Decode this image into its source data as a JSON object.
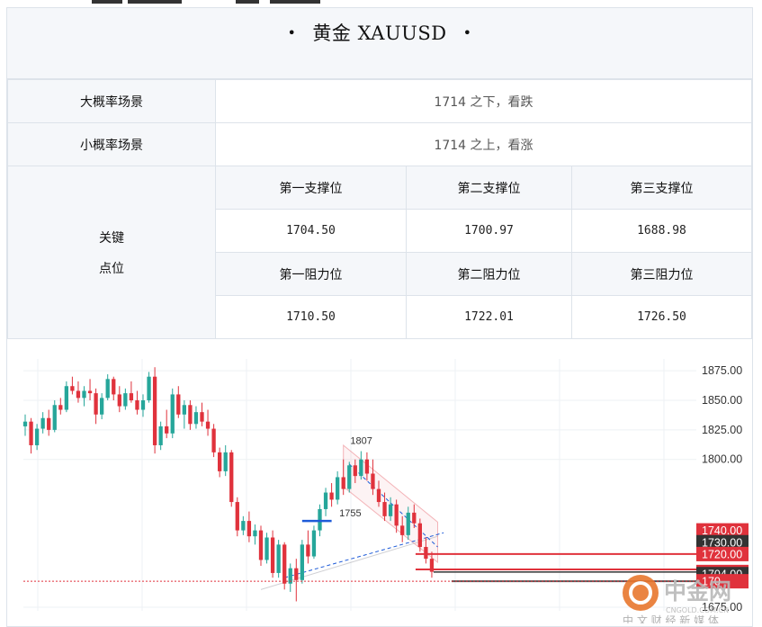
{
  "card": {
    "title": "黄金 XAUUSD",
    "bullet": "•"
  },
  "scenarios": {
    "major_label": "大概率场景",
    "major_text": "1714 之下，看跌",
    "minor_label": "小概率场景",
    "minor_text": "1714 之上，看涨"
  },
  "key_levels": {
    "label_line1": "关键",
    "label_line2": "点位",
    "support_headers": [
      "第一支撑位",
      "第二支撑位",
      "第三支撑位"
    ],
    "support_values": [
      "1704.50",
      "1700.97",
      "1688.98"
    ],
    "resistance_headers": [
      "第一阻力位",
      "第二阻力位",
      "第三阻力位"
    ],
    "resistance_values": [
      "1710.50",
      "1722.01",
      "1726.50"
    ]
  },
  "chart": {
    "y_axis_labels": [
      "1875.00",
      "1850.00",
      "1825.00",
      "1800.00",
      "1675.00"
    ],
    "price_tags": [
      {
        "label": "1740.00",
        "color": "#e0323c"
      },
      {
        "label": "1730.00",
        "color": "#333333"
      },
      {
        "label": "1720.00",
        "color": "#e0323c"
      },
      {
        "label": "1704.81",
        "color": "#e0323c"
      },
      {
        "label": "1704.00",
        "color": "#333333"
      },
      {
        "label": "170",
        "color": "#e0323c"
      }
    ],
    "annotations": {
      "high": "1807",
      "low": "1755"
    },
    "colors": {
      "up": "#26a69a",
      "down": "#e0323c",
      "grid": "#eef1f4"
    }
  },
  "watermark": {
    "brand": "中金网",
    "domain": "CNGOLD.COM.CN",
    "tagline": "中 文 财 经 新 媒 体"
  },
  "chart_data": {
    "type": "candlestick",
    "title": "",
    "xlabel": "",
    "ylabel": "",
    "ylim": [
      1672,
      1885
    ],
    "y_ticks": [
      1875,
      1850,
      1825,
      1800,
      1675
    ],
    "levels": [
      1740.0,
      1730.0,
      1720.0,
      1704.81,
      1704.0,
      1700.0
    ],
    "annotations": [
      {
        "label": "1807",
        "value": 1807
      },
      {
        "label": "1755",
        "value": 1755
      }
    ],
    "grid": true,
    "candles": [
      [
        1828,
        1838,
        1820,
        1832
      ],
      [
        1832,
        1835,
        1805,
        1812
      ],
      [
        1812,
        1830,
        1808,
        1826
      ],
      [
        1826,
        1840,
        1822,
        1835
      ],
      [
        1835,
        1842,
        1820,
        1825
      ],
      [
        1825,
        1850,
        1823,
        1846
      ],
      [
        1846,
        1852,
        1838,
        1842
      ],
      [
        1842,
        1866,
        1840,
        1862
      ],
      [
        1862,
        1870,
        1855,
        1858
      ],
      [
        1858,
        1866,
        1848,
        1852
      ],
      [
        1852,
        1862,
        1845,
        1858
      ],
      [
        1858,
        1868,
        1850,
        1856
      ],
      [
        1856,
        1860,
        1830,
        1838
      ],
      [
        1838,
        1856,
        1834,
        1852
      ],
      [
        1852,
        1872,
        1850,
        1868
      ],
      [
        1868,
        1870,
        1850,
        1855
      ],
      [
        1855,
        1862,
        1840,
        1845
      ],
      [
        1845,
        1860,
        1842,
        1856
      ],
      [
        1856,
        1866,
        1848,
        1850
      ],
      [
        1850,
        1858,
        1838,
        1842
      ],
      [
        1842,
        1855,
        1836,
        1850
      ],
      [
        1850,
        1874,
        1848,
        1870
      ],
      [
        1870,
        1878,
        1805,
        1812
      ],
      [
        1812,
        1832,
        1808,
        1828
      ],
      [
        1828,
        1842,
        1818,
        1822
      ],
      [
        1822,
        1860,
        1818,
        1855
      ],
      [
        1855,
        1862,
        1835,
        1838
      ],
      [
        1838,
        1850,
        1826,
        1846
      ],
      [
        1846,
        1850,
        1825,
        1830
      ],
      [
        1830,
        1845,
        1826,
        1840
      ],
      [
        1840,
        1848,
        1828,
        1832
      ],
      [
        1832,
        1842,
        1820,
        1826
      ],
      [
        1826,
        1830,
        1802,
        1806
      ],
      [
        1806,
        1810,
        1785,
        1790
      ],
      [
        1790,
        1812,
        1786,
        1806
      ],
      [
        1806,
        1808,
        1760,
        1764
      ],
      [
        1764,
        1768,
        1735,
        1740
      ],
      [
        1740,
        1752,
        1736,
        1748
      ],
      [
        1748,
        1756,
        1730,
        1735
      ],
      [
        1735,
        1745,
        1728,
        1740
      ],
      [
        1740,
        1744,
        1710,
        1715
      ],
      [
        1715,
        1738,
        1712,
        1734
      ],
      [
        1734,
        1740,
        1700,
        1704
      ],
      [
        1704,
        1732,
        1700,
        1728
      ],
      [
        1728,
        1730,
        1690,
        1695
      ],
      [
        1695,
        1712,
        1688,
        1708
      ],
      [
        1708,
        1716,
        1680,
        1698
      ],
      [
        1698,
        1732,
        1695,
        1728
      ],
      [
        1728,
        1740,
        1712,
        1718
      ],
      [
        1718,
        1744,
        1716,
        1740
      ],
      [
        1740,
        1762,
        1735,
        1758
      ],
      [
        1758,
        1776,
        1752,
        1772
      ],
      [
        1772,
        1780,
        1760,
        1766
      ],
      [
        1766,
        1790,
        1762,
        1785
      ],
      [
        1785,
        1800,
        1770,
        1775
      ],
      [
        1775,
        1798,
        1772,
        1795
      ],
      [
        1795,
        1800,
        1780,
        1786
      ],
      [
        1786,
        1807,
        1783,
        1800
      ],
      [
        1800,
        1806,
        1782,
        1788
      ],
      [
        1788,
        1800,
        1770,
        1775
      ],
      [
        1775,
        1782,
        1760,
        1764
      ],
      [
        1764,
        1772,
        1748,
        1752
      ],
      [
        1752,
        1768,
        1748,
        1762
      ],
      [
        1762,
        1766,
        1738,
        1744
      ],
      [
        1744,
        1752,
        1730,
        1736
      ],
      [
        1736,
        1760,
        1732,
        1755
      ],
      [
        1755,
        1762,
        1742,
        1746
      ],
      [
        1746,
        1750,
        1722,
        1726
      ],
      [
        1726,
        1734,
        1712,
        1716
      ],
      [
        1716,
        1722,
        1700,
        1705
      ]
    ]
  }
}
